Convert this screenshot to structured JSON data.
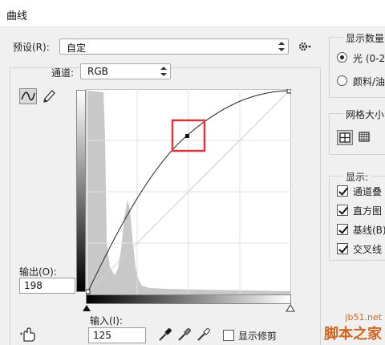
{
  "window": {
    "title": "曲线"
  },
  "preset": {
    "label": "预设(R):",
    "value": "自定"
  },
  "channel": {
    "label": "通道:",
    "value": "RGB"
  },
  "display_amount": {
    "group_label": "显示数量",
    "options": [
      {
        "label": "光 (0-2",
        "selected": true
      },
      {
        "label": "颜料/油",
        "selected": false
      }
    ]
  },
  "grid_size": {
    "group_label": "网格大小"
  },
  "show": {
    "group_label": "显示:",
    "items": [
      {
        "label": "通道叠",
        "checked": true
      },
      {
        "label": "直方图",
        "checked": true
      },
      {
        "label": "基线(B)",
        "checked": true
      },
      {
        "label": "交叉线",
        "checked": true
      }
    ]
  },
  "output": {
    "label": "输出(O):",
    "value": "198"
  },
  "input": {
    "label": "输入(I):",
    "value": "125"
  },
  "show_clipping": {
    "label": "显示修剪",
    "checked": false
  },
  "curve": {
    "selected_point": {
      "input": 125,
      "output": 198
    }
  },
  "watermark": {
    "line1": "jb51.net",
    "line2": "脚本之家"
  },
  "colors": {
    "highlight_box": "#d9383a",
    "histogram": "#c8c8c8",
    "watermark": "#d2641e"
  }
}
